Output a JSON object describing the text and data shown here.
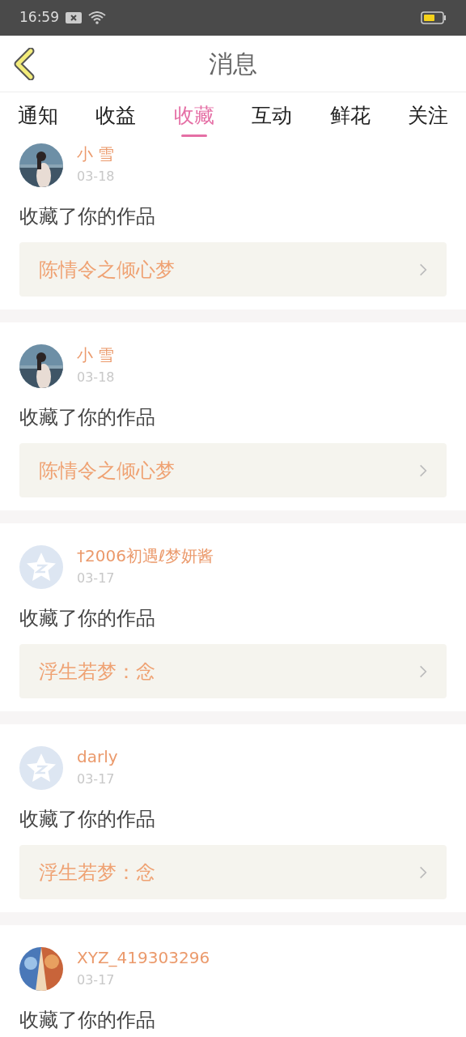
{
  "status_bar": {
    "time": "16:59"
  },
  "header": {
    "title": "消息"
  },
  "tabs": [
    {
      "label": "通知",
      "selected": false
    },
    {
      "label": "收益",
      "selected": false
    },
    {
      "label": "收藏",
      "selected": true
    },
    {
      "label": "互动",
      "selected": false
    },
    {
      "label": "鲜花",
      "selected": false
    },
    {
      "label": "关注",
      "selected": false
    }
  ],
  "messages": [
    {
      "name": "小 雪",
      "date": "03-18",
      "text": "收藏了你的作品",
      "work": "陈情令之倾心梦"
    },
    {
      "name": "小 雪",
      "date": "03-18",
      "text": "收藏了你的作品",
      "work": "陈情令之倾心梦"
    },
    {
      "kind": "default",
      "name": "†2006初遇ℓ梦妍酱",
      "date": "03-17",
      "text": "收藏了你的作品",
      "work": "浮生若梦：念"
    },
    {
      "kind": "default",
      "name": "darly",
      "date": "03-17",
      "text": "收藏了你的作品",
      "work": "浮生若梦：念"
    },
    {
      "kind": "art",
      "name": "XYZ_419303296",
      "date": "03-17",
      "text": "收藏了你的作品"
    }
  ]
}
